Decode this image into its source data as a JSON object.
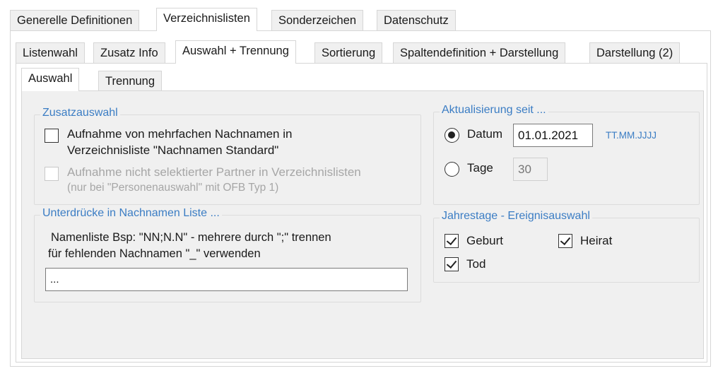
{
  "main_tabs": [
    "Generelle Definitionen",
    "Verzeichnislisten",
    "Sonderzeichen",
    "Datenschutz"
  ],
  "sub_tabs": [
    "Listenwahl",
    "Zusatz Info",
    "Auswahl + Trennung",
    "Sortierung",
    "Spaltendefinition + Darstellung",
    "Darstellung (2)"
  ],
  "inner_tabs": [
    "Auswahl",
    "Trennung"
  ],
  "zusatzauswahl": {
    "title": "Zusatzauswahl",
    "option1": {
      "line1": "Aufnahme von mehrfachen Nachnamen in",
      "line2": "Verzeichnisliste \"Nachnamen Standard\"",
      "checked": false
    },
    "option2": {
      "line1": "Aufnahme nicht selektierter Partner in Verzeichnislisten",
      "line2": "(nur bei \"Personenauswahl\" mit OFB Typ 1)",
      "checked": false,
      "disabled": true
    }
  },
  "aktualisierung": {
    "title": "Aktualisierung seit ...",
    "datum_label": "Datum",
    "datum_value": "01.01.2021",
    "date_format": "TT.MM.JJJJ",
    "tage_label": "Tage",
    "tage_value": "30",
    "selected": "Datum"
  },
  "unterdruecke": {
    "title": "Unterdrücke in Nachnamen Liste ...",
    "hint1": "Namenliste Bsp: \"NN;N.N\" - mehrere durch \";\" trennen",
    "hint2": "für fehlenden Nachnamen \"_\" verwenden",
    "value": "..."
  },
  "jahrestage": {
    "title": "Jahrestage - Ereignisauswahl",
    "geburt": "Geburt",
    "heirat": "Heirat",
    "tod": "Tod",
    "geburt_checked": true,
    "heirat_checked": true,
    "tod_checked": true
  },
  "colors": {
    "group_title": "#3b7dc4",
    "panel_bg": "#f0f0f0"
  }
}
